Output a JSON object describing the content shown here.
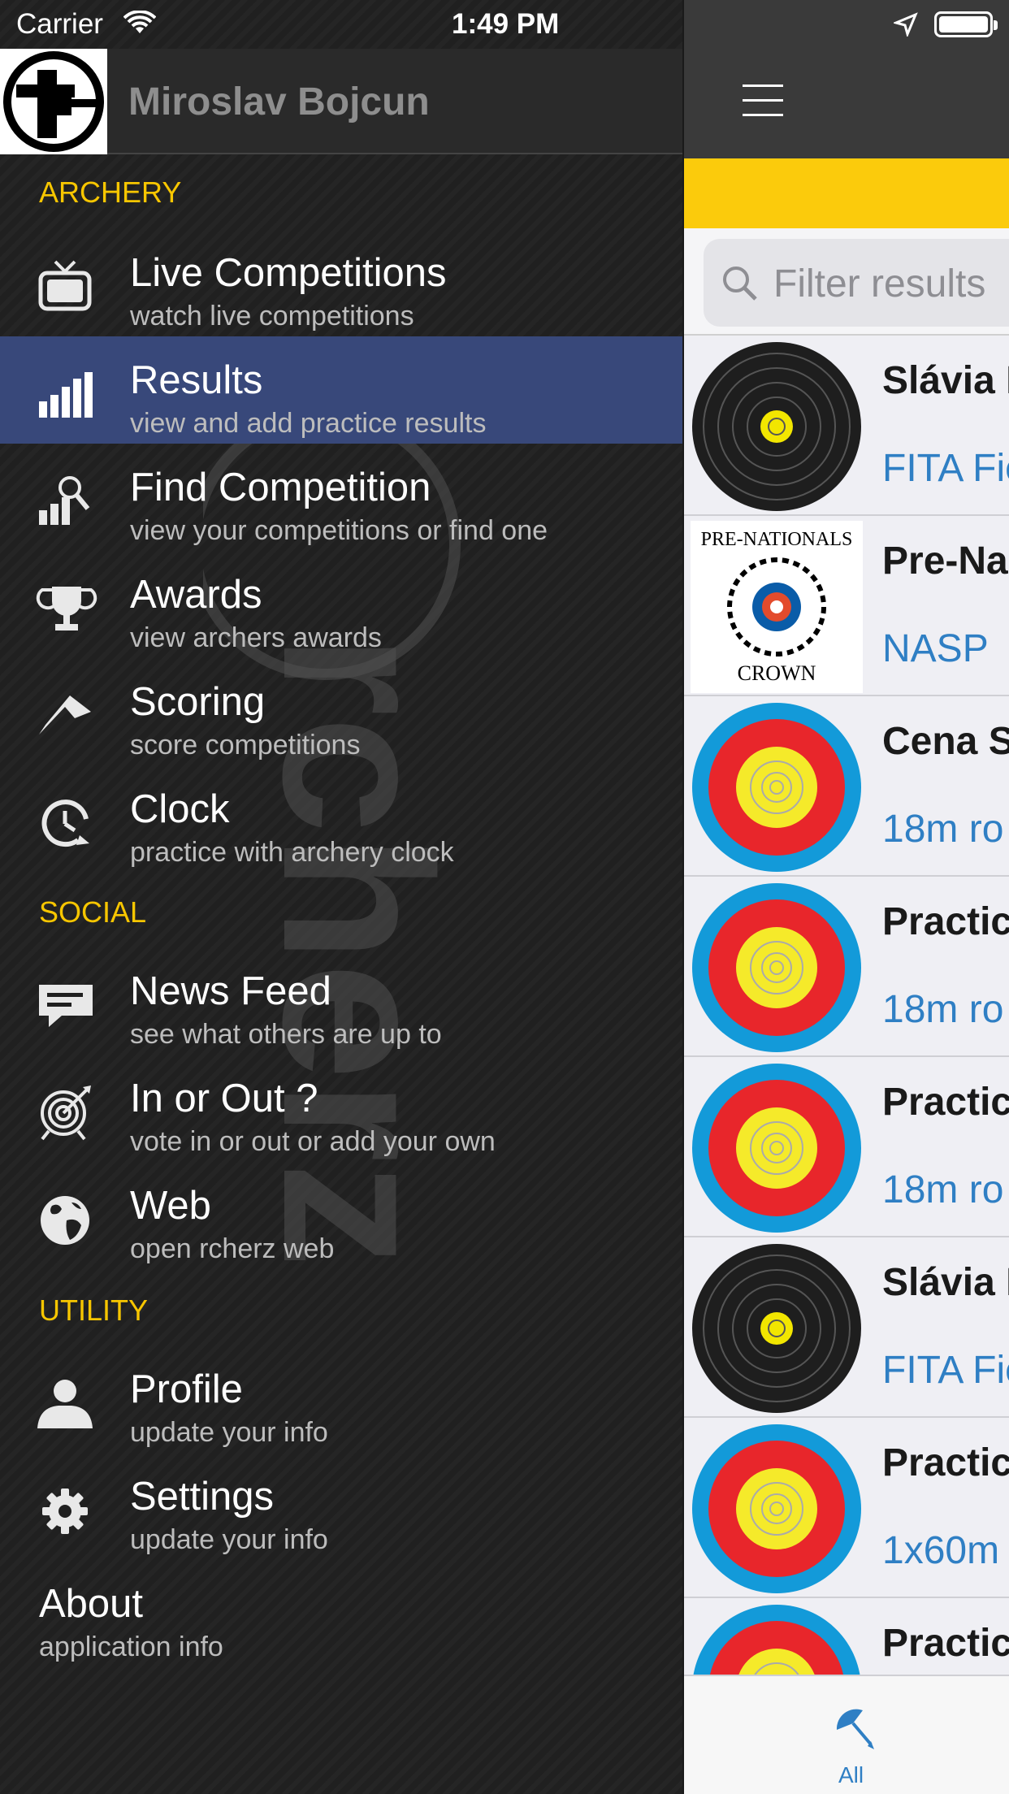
{
  "status_bar": {
    "carrier": "Carrier",
    "time": "1:49 PM"
  },
  "drawer": {
    "user_name": "Miroslav Bojcun",
    "sections": {
      "archery": "ARCHERY",
      "social": "SOCIAL",
      "utility": "UTILITY"
    },
    "items": [
      {
        "title": "Live Competitions",
        "subtitle": "watch live competitions",
        "icon": "tv-icon"
      },
      {
        "title": "Results",
        "subtitle": "view and add practice results",
        "icon": "bar-chart-icon",
        "selected": true
      },
      {
        "title": "Find Competition",
        "subtitle": "view your competitions or find one",
        "icon": "search-chart-icon"
      },
      {
        "title": "Awards",
        "subtitle": "view archers awards",
        "icon": "trophy-icon"
      },
      {
        "title": "Scoring",
        "subtitle": "score competitions",
        "icon": "arrow-up-icon"
      },
      {
        "title": "Clock",
        "subtitle": "practice with archery clock",
        "icon": "clock-icon"
      },
      {
        "title": "News Feed",
        "subtitle": "see what others are up to",
        "icon": "chat-bubble-icon"
      },
      {
        "title": "In or Out ?",
        "subtitle": "vote in or out or add your own",
        "icon": "target-arrow-icon"
      },
      {
        "title": "Web",
        "subtitle": "open rcherz web",
        "icon": "globe-icon"
      },
      {
        "title": "Profile",
        "subtitle": "update your info",
        "icon": "person-icon"
      },
      {
        "title": "Settings",
        "subtitle": "update your info",
        "icon": "gear-icon"
      },
      {
        "title": "About",
        "subtitle": "application info",
        "icon": ""
      }
    ],
    "watermark": "rcherz"
  },
  "content": {
    "search_placeholder": "Filter results",
    "results": [
      {
        "title": "Slávia I",
        "subtitle": "FITA Fie",
        "thumb": "field-target"
      },
      {
        "title": "Pre-Na",
        "subtitle": "NASP",
        "thumb": "pre-nationals-logo",
        "logo_text_top": "PRE-NATIONALS",
        "logo_text_bottom": "CROWN"
      },
      {
        "title": "Cena S",
        "subtitle": "18m ro",
        "thumb": "fita-target"
      },
      {
        "title": "Practic",
        "subtitle": "18m ro",
        "thumb": "fita-target"
      },
      {
        "title": "Practic",
        "subtitle": "18m ro",
        "thumb": "fita-target"
      },
      {
        "title": "Slávia I",
        "subtitle": "FITA Fie",
        "thumb": "field-target"
      },
      {
        "title": "Practic",
        "subtitle": "1x60m",
        "thumb": "fita-target"
      },
      {
        "title": "Practic",
        "subtitle": "",
        "thumb": "fita-target"
      }
    ],
    "tab_label": "All"
  },
  "colors": {
    "accent_yellow": "#f7c600",
    "selected_row": "#38487a",
    "link_blue": "#2f7fc4"
  }
}
